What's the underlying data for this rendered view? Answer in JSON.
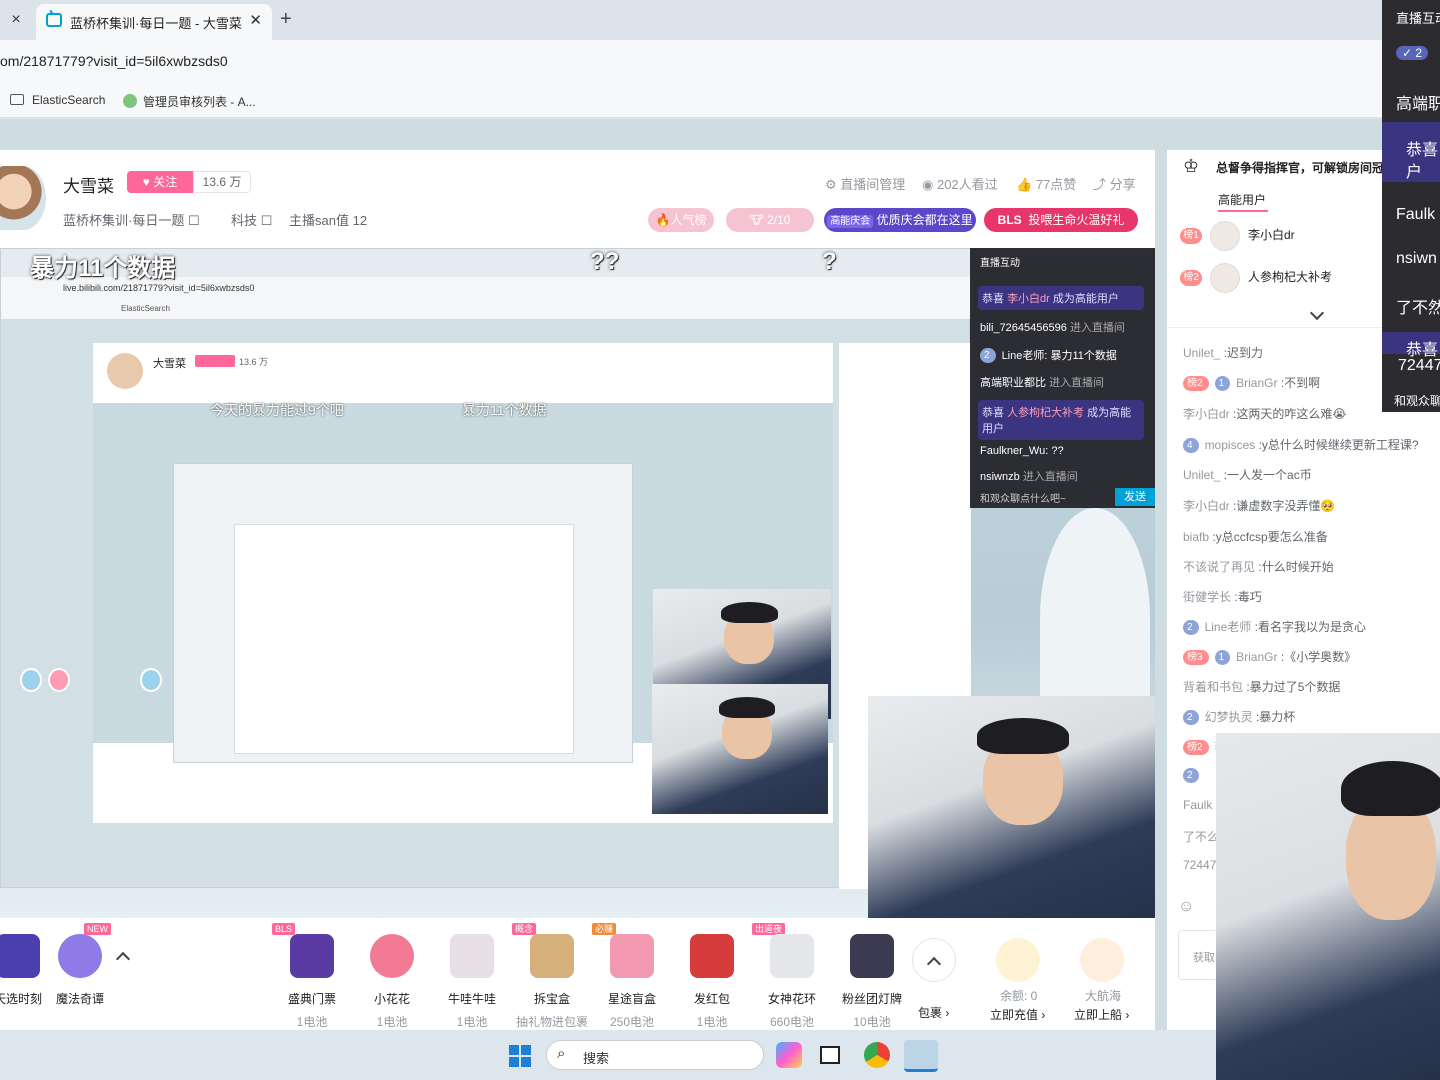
{
  "browser": {
    "tab_close_glyph": "×",
    "active_tab_title": "蓝桥杯集训·每日一题 - 大雪菜",
    "new_tab_glyph": "+",
    "url": "om/21871779?visit_id=5il6xwbzsds0",
    "bookmarks": [
      "ElasticSearch",
      "管理员审核列表 - A..."
    ]
  },
  "streamer": {
    "name": "大雪菜",
    "follow_label": "关注",
    "followers": "13.6 万",
    "room_title": "蓝桥杯集训·每日一题",
    "category": "科技",
    "san": "主播san值",
    "san_value": "12",
    "manage": "直播间管理",
    "viewers": "202人看过",
    "likes": "77点赞",
    "share": "分享"
  },
  "pills": {
    "popular": "人气榜",
    "progress": "2/10",
    "promo1": "优质庆会都在这里",
    "promo1_tag": "高能庆会",
    "promo2_brand": "BLS",
    "promo2": "投喂生命火温好礼"
  },
  "video": {
    "overlay_main": "暴力11个数据",
    "overlay_q1": "??",
    "overlay_q2": "?",
    "inner_overlay1": "今天的暴力能过9个吧",
    "inner_overlay2": "暴力11个数据",
    "inner_url": "live.bilibili.com/21871779?visit_id=5il6xwbzsds0",
    "inner_bm": "ElasticSearch",
    "inner_name": "大雪菜",
    "inner_followers": "13.6 万"
  },
  "inner_chat": {
    "title": "直播互动",
    "lines": [
      {
        "user": "恭喜",
        "name": "李小白dr",
        "text": "成为高能用户",
        "highlight": true
      },
      {
        "name": "bili_72645456596",
        "text": "进入直播间"
      },
      {
        "badge": "2",
        "name": "Line老师:",
        "text": "暴力11个数据"
      },
      {
        "name": "高端职业都比",
        "text": "进入直播间"
      },
      {
        "user": "恭喜",
        "name": "人参枸杞大补考",
        "text": "成为高能用户",
        "highlight": true
      },
      {
        "name": "Faulkner_Wu:",
        "text": "??"
      },
      {
        "name": "nsiwnzb",
        "text": "进入直播间"
      }
    ],
    "placeholder": "和观众聊点什么吧~",
    "send": "发送"
  },
  "gifts": [
    {
      "name": "天选时刻",
      "price": ""
    },
    {
      "name": "魔法奇谭",
      "price": "",
      "tag": "NEW"
    },
    {
      "name": "盛典门票",
      "price": "1电池",
      "tag": "BLS"
    },
    {
      "name": "小花花",
      "price": "1电池"
    },
    {
      "name": "牛哇牛哇",
      "price": "1电池"
    },
    {
      "name": "拆宝盒",
      "price": "抽礼物进包裹",
      "tag": "概念"
    },
    {
      "name": "星途盲盒",
      "price": "250电池",
      "tag": "必赚"
    },
    {
      "name": "发红包",
      "price": "1电池"
    },
    {
      "name": "女神花环",
      "price": "660电池",
      "tag": "出道夜"
    },
    {
      "name": "粉丝团灯牌",
      "price": "10电池"
    }
  ],
  "gift_bar": {
    "more": "包裹",
    "balance": "余额: 0",
    "recharge": "立即充值",
    "captain": "大航海",
    "board": "立即上船"
  },
  "taskbar": {
    "search_placeholder": "搜索"
  },
  "rank": {
    "title": "总督争得指挥官，可解锁房间冠名",
    "tab": "高能用户",
    "users": [
      {
        "rank": "榜1",
        "name": "李小白dr"
      },
      {
        "rank": "榜2",
        "name": "人参枸杞大补考"
      }
    ]
  },
  "chat": [
    {
      "user": "Unilet_",
      "msg": ":迟到力"
    },
    {
      "rank": "榜2",
      "level": "1",
      "user": "BrianGr",
      "msg": ":不到啊"
    },
    {
      "user": "李小白dr",
      "msg": ":这两天的咋这么难😭"
    },
    {
      "level": "4",
      "user": "mopisces",
      "msg": ":y总什么时候继续更新工程课?"
    },
    {
      "user": "Unilet_",
      "msg": ":一人发一个ac币"
    },
    {
      "user": "李小白dr",
      "msg": ":谦虚数字没弄懂🥺"
    },
    {
      "user": "biafb",
      "msg": ":y总ccfcsp要怎么准备"
    },
    {
      "user": "不该说了再见",
      "msg": ":什么时候开始"
    },
    {
      "user": "街健学长",
      "msg": ":毒巧"
    },
    {
      "level": "2",
      "user": "Line老师",
      "msg": ":看名字我以为是贪心"
    },
    {
      "rank": "榜3",
      "level": "1",
      "user": "BrianGr",
      "msg": ":《小学奥数》"
    },
    {
      "user": "背着和书包",
      "msg": ":暴力过了5个数据"
    },
    {
      "level": "2",
      "user": "幻梦执灵",
      "msg": ":暴力杯"
    },
    {
      "rank": "榜2",
      "user": "李",
      "msg": ""
    },
    {
      "level": "2",
      "user": "",
      "msg": ""
    },
    {
      "user": "Faulk",
      "msg": ""
    },
    {
      "user": "了不么",
      "msg": ""
    },
    {
      "user": "72447",
      "msg": ""
    }
  ],
  "chat_input_hint": "获取",
  "dark_overlay": {
    "title": "直播互动",
    "badge": "2",
    "l1": "高端职",
    "l2": "恭喜",
    "l2b": "户",
    "l3": "Faulk",
    "l4": "nsiwn",
    "l5": "了不然",
    "l6": "恭喜",
    "l7": "72447",
    "l8": "和观众聊"
  },
  "colors": {
    "pink": "#ff6699",
    "blue": "#00a1d6",
    "purple": "#6a4cd6",
    "bls_red": "#e8356a"
  }
}
